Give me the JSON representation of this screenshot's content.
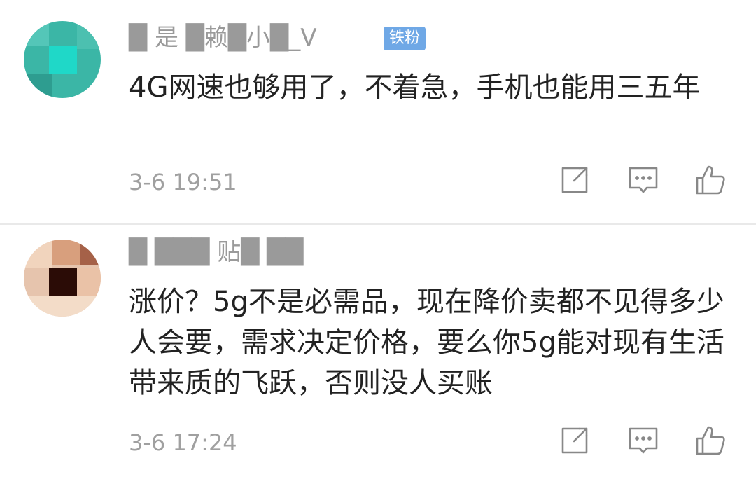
{
  "comments": [
    {
      "username": "█ 是 █赖█小█_V",
      "badge": "铁粉",
      "text": "4G网速也够用了，不着急，手机也能用三五年",
      "time": "3-6 19:51",
      "actions": {
        "share_icon": "share-icon",
        "reply_icon": "comment-icon",
        "like_icon": "thumbs-up-icon"
      }
    },
    {
      "username": "█ ███ 贴█ ██",
      "badge": "",
      "text": "涨价？5g不是必需品，现在降价卖都不见得多少人会要，需求决定价格，要么你5g能对现有生活带来质的飞跃，否则没人买账",
      "time": "3-6 17:24",
      "actions": {
        "share_icon": "share-icon",
        "reply_icon": "comment-icon",
        "like_icon": "thumbs-up-icon"
      }
    }
  ],
  "colors": {
    "badge": "#6fa8e6",
    "time": "#a0a0a0",
    "text": "#222222",
    "icon": "#888888"
  }
}
